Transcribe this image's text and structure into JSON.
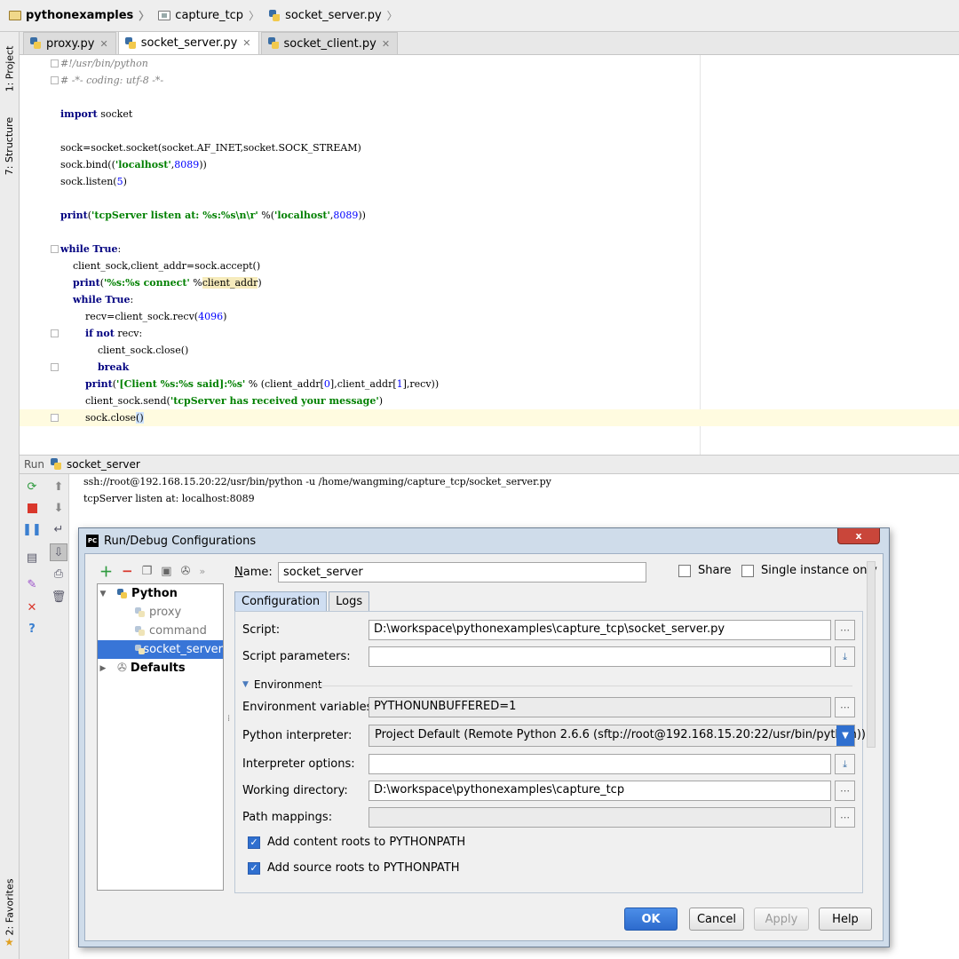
{
  "breadcrumb": [
    {
      "label": "pythonexamples",
      "icon": "folder-icon"
    },
    {
      "label": "capture_tcp",
      "icon": "package-icon"
    },
    {
      "label": "socket_server.py",
      "icon": "python-file-icon"
    }
  ],
  "side_tabs": {
    "project": "1: Project",
    "structure": "7: Structure",
    "favorites": "2: Favorites"
  },
  "tabs": [
    {
      "label": "proxy.py",
      "active": false
    },
    {
      "label": "socket_server.py",
      "active": true
    },
    {
      "label": "socket_client.py",
      "active": false
    }
  ],
  "editor": {
    "lines": [
      "#!/usr/bin/python",
      "# -*- coding: utf-8 -*-",
      "",
      "import socket",
      "",
      "sock=socket.socket(socket.AF_INET,socket.SOCK_STREAM)",
      "sock.bind(('localhost',8089))",
      "sock.listen(5)",
      "",
      "print('tcpServer listen at: %s:%s\\n\\r' %('localhost',8089))",
      "",
      "while True:",
      "    client_sock,client_addr=sock.accept()",
      "    print('%s:%s connect' %client_addr)",
      "    while True:",
      "        recv=client_sock.recv(4096)",
      "        if not recv:",
      "            client_sock.close()",
      "            break",
      "        print('[Client %s:%s said]:%s' % (client_addr[0],client_addr[1],recv))",
      "        client_sock.send('tcpServer has received your message')",
      "        sock.close()"
    ]
  },
  "run": {
    "label": "Run",
    "config_name": "socket_server",
    "console": [
      "ssh://root@192.168.15.20:22/usr/bin/python -u /home/wangming/capture_tcp/socket_server.py",
      "tcpServer listen at: localhost:8089"
    ]
  },
  "dialog": {
    "title": "Run/Debug Configurations",
    "close": "x",
    "tree": {
      "python_group": "Python",
      "items": [
        "proxy",
        "command",
        "socket_server"
      ],
      "selected": "socket_server",
      "defaults": "Defaults"
    },
    "name_label": "Name:",
    "name_value": "socket_server",
    "share_label": "Share",
    "single_instance_label": "Single instance only",
    "tabs": [
      "Configuration",
      "Logs"
    ],
    "script_label": "Script:",
    "script_value": "D:\\workspace\\pythonexamples\\capture_tcp\\socket_server.py",
    "script_params_label": "Script parameters:",
    "script_params_value": "",
    "environment_label": "Environment",
    "env_vars_label": "Environment variables:",
    "env_vars_value": "PYTHONUNBUFFERED=1",
    "interpreter_label": "Python interpreter:",
    "interpreter_value": "Project Default (Remote Python 2.6.6 (sftp://root@192.168.15.20:22/usr/bin/python))",
    "interp_options_label": "Interpreter options:",
    "interp_options_value": "",
    "working_dir_label": "Working directory:",
    "working_dir_value": "D:\\workspace\\pythonexamples\\capture_tcp",
    "path_mappings_label": "Path mappings:",
    "path_mappings_value": "",
    "add_content_roots": "Add content roots to PYTHONPATH",
    "add_source_roots": "Add source roots to PYTHONPATH",
    "buttons": {
      "ok": "OK",
      "cancel": "Cancel",
      "apply": "Apply",
      "help": "Help"
    }
  },
  "colors": {
    "accent": "#2f6fcf",
    "keyword": "#000080",
    "string": "#008000",
    "number": "#0000ff",
    "selection": "#3875d7"
  }
}
